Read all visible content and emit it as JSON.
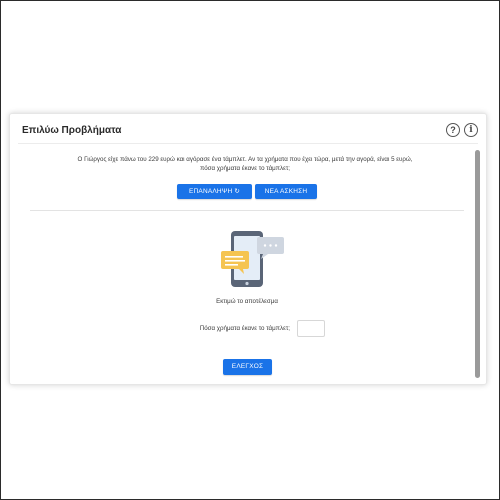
{
  "card": {
    "title": "Επιλύω Προβλήματα",
    "help_icon_glyph": "?",
    "info_icon_glyph": "i"
  },
  "problem": {
    "text_line1": "Ο Γιώργος είχε πάνω του 229 ευρώ και αγόρασε ένα τάμπλετ. Αν τα χρήματα που έχει τώρα, μετά την αγορά, είναι 5 ευρώ,",
    "text_line2": "πόσα χρήματα έκανε το τάμπλετ;"
  },
  "buttons": {
    "repeat_label": "ΕΠΑΝΑΛΗΨΗ ↻",
    "new_exercise_label": "ΝΕΑ ΑΣΚΗΣΗ",
    "check_label": "ΕΛΕΓΧΟΣ"
  },
  "answer": {
    "estimate_label": "Εκτιμώ το αποτέλεσμα",
    "question_label": "Πόσα χρήματα έκανε το τάμπλετ;",
    "input_value": ""
  },
  "icons": {
    "help": "help-icon",
    "info": "info-icon",
    "illustration": "tablet-chat-illustration"
  },
  "colors": {
    "primary_button": "#1a73e8",
    "button_text": "#ffffff",
    "tablet_frame": "#5a6577",
    "tablet_screen": "#e4edf7",
    "bubble_yellow": "#f5c451",
    "bubble_grey": "#cfd6e0"
  }
}
